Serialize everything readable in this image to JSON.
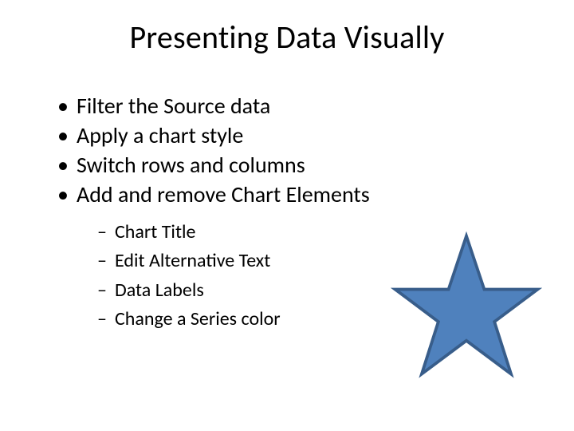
{
  "title": "Presenting Data Visually",
  "bullets": [
    {
      "text": "Filter the Source data"
    },
    {
      "text": "Apply a chart style"
    },
    {
      "text": "Switch rows and columns"
    },
    {
      "text": "Add and remove Chart Elements"
    }
  ],
  "sub_bullets": [
    {
      "text": "Chart Title"
    },
    {
      "text": "Edit Alternative Text"
    },
    {
      "text": "Data Labels"
    },
    {
      "text": "Change a Series color"
    }
  ],
  "star": {
    "fill": "#4f81bd",
    "stroke": "#385d8a"
  }
}
